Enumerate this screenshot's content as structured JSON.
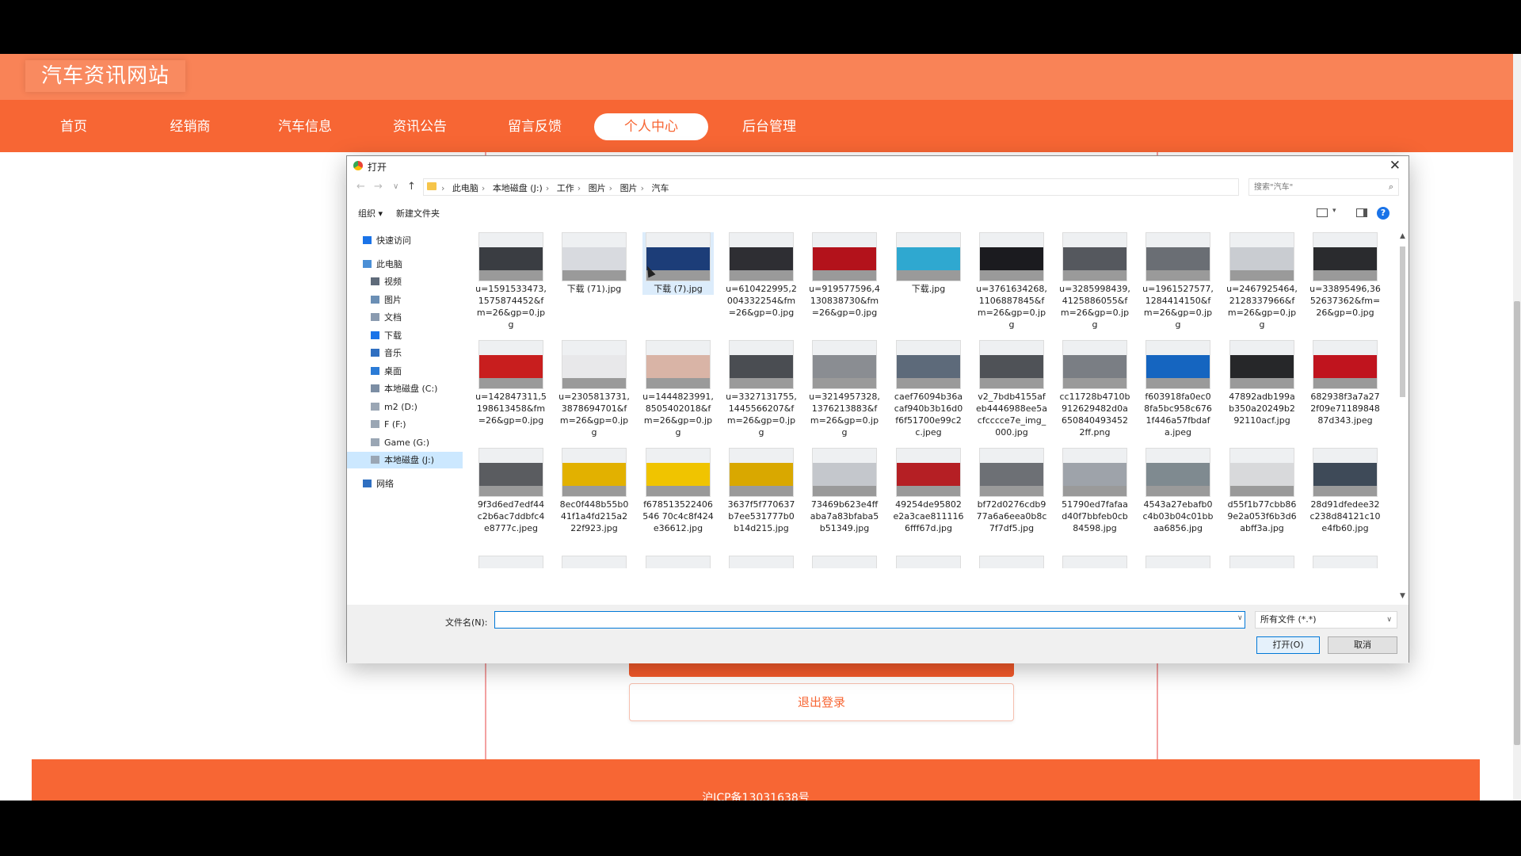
{
  "site": {
    "title": "汽车资讯网站",
    "nav": [
      "首页",
      "经销商",
      "汽车信息",
      "资讯公告",
      "留言反馈",
      "个人中心",
      "后台管理"
    ],
    "active_nav": "个人中心",
    "logout_label": "退出登录",
    "footer_text": "沪ICP备13031638号"
  },
  "dialog": {
    "title": "打开",
    "close": "✕",
    "breadcrumbs": [
      "此电脑",
      "本地磁盘 (J:)",
      "工作",
      "图片",
      "图片",
      "汽车"
    ],
    "search_placeholder": "搜索\"汽车\"",
    "toolbar": {
      "organize": "组织 ▾",
      "new_folder": "新建文件夹"
    },
    "sidebar": [
      {
        "label": "快速访问",
        "icon": "star-icon",
        "color": "#1a73e8"
      },
      {
        "label": "此电脑",
        "icon": "computer-icon",
        "color": "#4a8fd6"
      },
      {
        "label": "视频",
        "icon": "video-icon",
        "color": "#5f6b7a"
      },
      {
        "label": "图片",
        "icon": "pictures-icon",
        "color": "#6b8fb5"
      },
      {
        "label": "文档",
        "icon": "documents-icon",
        "color": "#8a9bb0"
      },
      {
        "label": "下载",
        "icon": "download-icon",
        "color": "#1a73e8"
      },
      {
        "label": "音乐",
        "icon": "music-icon",
        "color": "#2f6fc1"
      },
      {
        "label": "桌面",
        "icon": "desktop-icon",
        "color": "#2b7bd6"
      },
      {
        "label": "本地磁盘 (C:)",
        "icon": "drive-icon",
        "color": "#7c8ea4"
      },
      {
        "label": "m2 (D:)",
        "icon": "drive-icon",
        "color": "#9aa6b4"
      },
      {
        "label": "F (F:)",
        "icon": "drive-icon",
        "color": "#9aa6b4"
      },
      {
        "label": "Game (G:)",
        "icon": "drive-icon",
        "color": "#9aa6b4"
      },
      {
        "label": "本地磁盘 (J:)",
        "icon": "drive-icon",
        "color": "#9aa6b4",
        "selected": true
      },
      {
        "label": "网络",
        "icon": "network-icon",
        "color": "#2f6fc1"
      }
    ],
    "files": [
      {
        "name": "u=1591533473,1575874452&fm=26&gp=0.jpg",
        "color": "#3a3d42"
      },
      {
        "name": "下载 (71).jpg",
        "color": "#d8dadf"
      },
      {
        "name": "下载 (7).jpg",
        "color": "#1c3d78",
        "selected": true
      },
      {
        "name": "u=610422995,2004332254&fm=26&gp=0.jpg",
        "color": "#2e2e33"
      },
      {
        "name": "u=919577596,4130838730&fm=26&gp=0.jpg",
        "color": "#b3121b"
      },
      {
        "name": "下载.jpg",
        "color": "#2fa8d0"
      },
      {
        "name": "u=3761634268,1106887845&fm=26&gp=0.jpg",
        "color": "#1b1b1f"
      },
      {
        "name": "u=3285998439,4125886055&fm=26&gp=0.jpg",
        "color": "#55585e"
      },
      {
        "name": "u=1961527577,1284414150&fm=26&gp=0.jpg",
        "color": "#6a6e74"
      },
      {
        "name": "u=2467925464,2128337966&fm=26&gp=0.jpg",
        "color": "#c9ccd1"
      },
      {
        "name": "u=33895496,3652637362&fm=26&gp=0.jpg",
        "color": "#2a2b2e"
      },
      {
        "name": "u=142847311,5198613458&fm=26&gp=0.jpg",
        "color": "#c81e1e"
      },
      {
        "name": "u=2305813731,3878694701&fm=26&gp=0.jpg",
        "color": "#e8e8ea"
      },
      {
        "name": "u=1444823991,8505402018&fm=26&gp=0.jpg",
        "color": "#d9b4a6"
      },
      {
        "name": "u=3327131755,1445566207&fm=26&gp=0.jpg",
        "color": "#4a4d52"
      },
      {
        "name": "u=3214957328,1376213883&fm=26&gp=0.jpg",
        "color": "#8a8d92"
      },
      {
        "name": "caef76094b36acaf940b3b16d0f6f51700e99c2c.jpeg",
        "color": "#5d6a7a"
      },
      {
        "name": "v2_7bdb4155afeb4446988ee5acfcccce7e_img_000.jpg",
        "color": "#4f5257"
      },
      {
        "name": "cc11728b4710b912629482d0a6508404934522ff.png",
        "color": "#7a7e84"
      },
      {
        "name": "f603918fa0ec08fa5bc958c6761f446a57fbdafa.jpeg",
        "color": "#1565c0"
      },
      {
        "name": "47892adb199ab350a20249b292110acf.jpg",
        "color": "#262729"
      },
      {
        "name": "682938f3a7a272f09e7118984887d343.jpeg",
        "color": "#c0141e"
      },
      {
        "name": "9f3d6ed7edf44c2b6ac7ddbfc4e8777c.jpeg",
        "color": "#5a5c60"
      },
      {
        "name": "8ec0f448b55b041f1a4fd215a222f923.jpg",
        "color": "#e2b100"
      },
      {
        "name": "f678513522406546 70c4c8f424e36612.jpg",
        "color": "#f0c400"
      },
      {
        "name": "3637f5f770637b7ee531777b0b14d215.jpg",
        "color": "#d9a800"
      },
      {
        "name": "73469b623e4ffaba7a83bfaba5b51349.jpg",
        "color": "#c4c7cc"
      },
      {
        "name": "49254de95802e2a3cae8111166fff67d.jpg",
        "color": "#b51f24"
      },
      {
        "name": "bf72d0276cdb977a6a6eea0b8c7f7df5.jpg",
        "color": "#6d7075"
      },
      {
        "name": "51790ed7fafaad40f7bbfeb0cb84598.jpg",
        "color": "#9ea3aa"
      },
      {
        "name": "4543a27ebafb0c4b03b04c01bbaa6856.jpg",
        "color": "#7f8a90"
      },
      {
        "name": "d55f1b77cbb869e2a053f6b3d6abff3a.jpg",
        "color": "#d8d9db"
      },
      {
        "name": "28d91dfedee32c238d84121c10e4fb60.jpg",
        "color": "#3e4a58"
      },
      {
        "name": "",
        "color": "#b9bcc0"
      },
      {
        "name": "",
        "color": "#3c4a5a"
      },
      {
        "name": "",
        "color": "#b21d22"
      },
      {
        "name": "",
        "color": "#c2202a"
      },
      {
        "name": "",
        "color": "#2b2c30"
      },
      {
        "name": "",
        "color": "#1e5aa8"
      },
      {
        "name": "",
        "color": "#1d3e9e"
      },
      {
        "name": "",
        "color": "#6e6a66"
      },
      {
        "name": "",
        "color": "#d0d2d6"
      },
      {
        "name": "",
        "color": "#a3202a"
      },
      {
        "name": "",
        "color": "#cfd1d4"
      }
    ],
    "filename_label": "文件名(N):",
    "filename_value": "",
    "filetype": "所有文件 (*.*)",
    "open_label": "打开(O)",
    "cancel_label": "取消"
  }
}
